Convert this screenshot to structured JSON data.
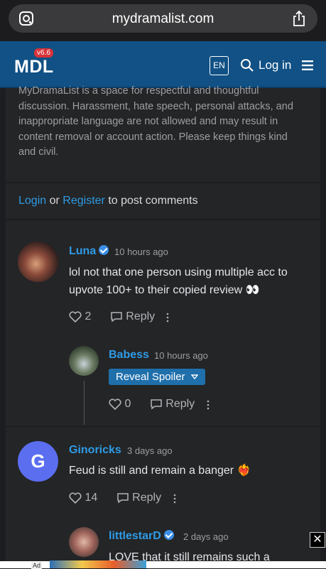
{
  "browser": {
    "url": "mydramalist.com"
  },
  "header": {
    "logo": "MDL",
    "version": "v6.6",
    "lang": "EN",
    "login": "Log in"
  },
  "notice": {
    "text": "MyDramaList is a space for respectful and thoughtful discussion. Harassment, hate speech, personal attacks, and inappropriate language are not allowed and may result in content removal or account action. Please keep things kind and civil."
  },
  "post_prompt": {
    "login": "Login",
    "or": "or",
    "register": "Register",
    "suffix": "to post comments"
  },
  "comments": [
    {
      "user": "Luna",
      "time": "10 hours ago",
      "text1": "lol not that one person using multiple acc to",
      "text2": "upvote 100+ to their copied review 👀",
      "likes": "2",
      "reply": "Reply"
    },
    {
      "user": "Babess",
      "time": "10 hours ago",
      "spoiler": "Reveal Spoiler",
      "likes": "0",
      "reply": "Reply"
    },
    {
      "user": "Ginoricks",
      "initial": "G",
      "time": "3 days ago",
      "text1": "Feud is still and remain a banger ❤️‍🔥",
      "likes": "14",
      "reply": "Reply"
    },
    {
      "user": "littlestarD",
      "time": "2 days ago",
      "text1": "LOVE that it still remains such a"
    }
  ],
  "ad": {
    "label": "Ad",
    "close": "✕"
  },
  "colors": {
    "accent": "#2e9be6",
    "header": "#115185",
    "card": "#242526"
  }
}
